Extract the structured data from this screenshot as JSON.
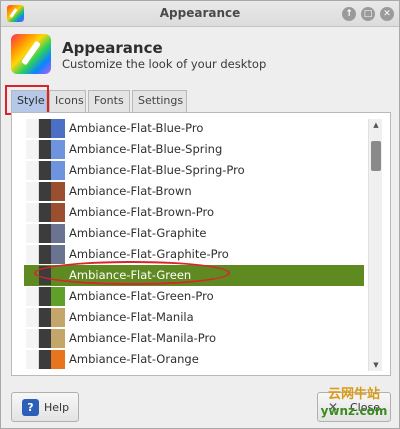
{
  "window": {
    "title": "Appearance",
    "buttons": {
      "keep_above": "↑",
      "maximize": "□",
      "close": "✕"
    }
  },
  "header": {
    "title": "Appearance",
    "subtitle": "Customize the look of your desktop"
  },
  "tabs": [
    {
      "label": "Style",
      "active": true
    },
    {
      "label": "Icons",
      "active": false
    },
    {
      "label": "Fonts",
      "active": false
    },
    {
      "label": "Settings",
      "active": false
    }
  ],
  "themes": [
    {
      "name": "Ambiance-Flat-Blue-Pro",
      "swatch": "#4a6fc4"
    },
    {
      "name": "Ambiance-Flat-Blue-Spring",
      "swatch": "#6f94df"
    },
    {
      "name": "Ambiance-Flat-Blue-Spring-Pro",
      "swatch": "#6f94df"
    },
    {
      "name": "Ambiance-Flat-Brown",
      "swatch": "#9a5030"
    },
    {
      "name": "Ambiance-Flat-Brown-Pro",
      "swatch": "#9a5030"
    },
    {
      "name": "Ambiance-Flat-Graphite",
      "swatch": "#6a7490"
    },
    {
      "name": "Ambiance-Flat-Graphite-Pro",
      "swatch": "#6a7490"
    },
    {
      "name": "Ambiance-Flat-Green",
      "swatch": "#5f8a22",
      "selected": true
    },
    {
      "name": "Ambiance-Flat-Green-Pro",
      "swatch": "#5fa02a"
    },
    {
      "name": "Ambiance-Flat-Manila",
      "swatch": "#c4a66a"
    },
    {
      "name": "Ambiance-Flat-Manila-Pro",
      "swatch": "#c4a66a"
    },
    {
      "name": "Ambiance-Flat-Orange",
      "swatch": "#e8741e"
    }
  ],
  "scrollbar": {
    "up": "▲",
    "down": "▼"
  },
  "footer": {
    "help_icon": "?",
    "help_label": "Help",
    "close_icon": "✕",
    "close_label": "Close"
  },
  "watermark": {
    "line1": "云网牛站",
    "line2": "ywnz.com"
  },
  "colors": {
    "selected_row": "#5f8a22",
    "active_tab": "#b5c8e8",
    "annotation": "#d9242b"
  }
}
